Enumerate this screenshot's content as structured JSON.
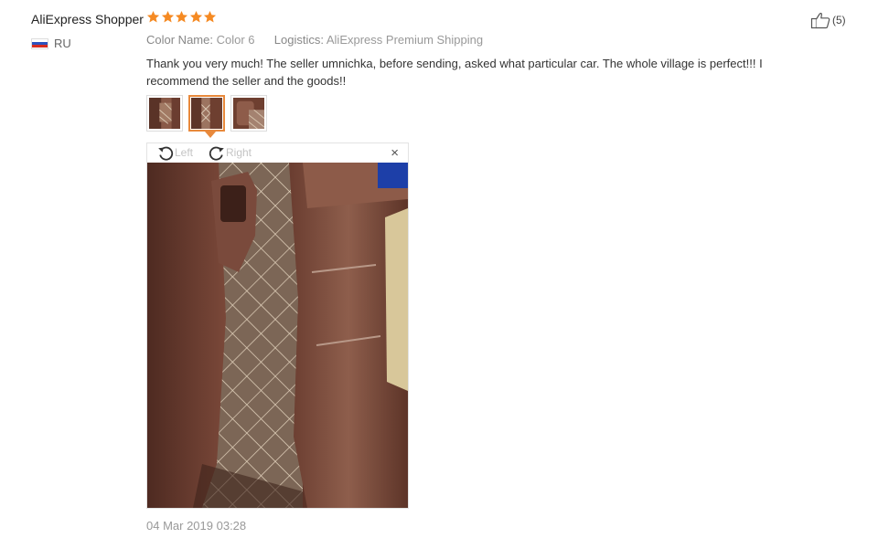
{
  "review": {
    "reviewer": "AliExpress Shopper",
    "rating": 5,
    "country_code": "RU",
    "color_name_label": "Color Name:",
    "color_name_value": "Color 6",
    "logistics_label": "Logistics:",
    "logistics_value": "AliExpress Premium Shipping",
    "text": "Thank you very much! The seller umnichka, before sending, asked what particular car. The whole village is perfect!!! I recommend the seller and the goods!!",
    "helpful_count": "(5)",
    "date": "04 Mar 2019 03:28"
  },
  "viewer": {
    "rotate_left_label": "Left",
    "rotate_right_label": "Right",
    "close_label": "×",
    "selected_thumbnail": 2
  },
  "colors": {
    "star": "#f58a23",
    "accent": "#e8893c",
    "leather": "#6e3f30",
    "mat": "#8a7666"
  },
  "icons": [
    "star-icon",
    "russia-flag-icon",
    "thumbs-up-icon",
    "rotate-left-icon",
    "rotate-right-icon",
    "close-icon"
  ]
}
